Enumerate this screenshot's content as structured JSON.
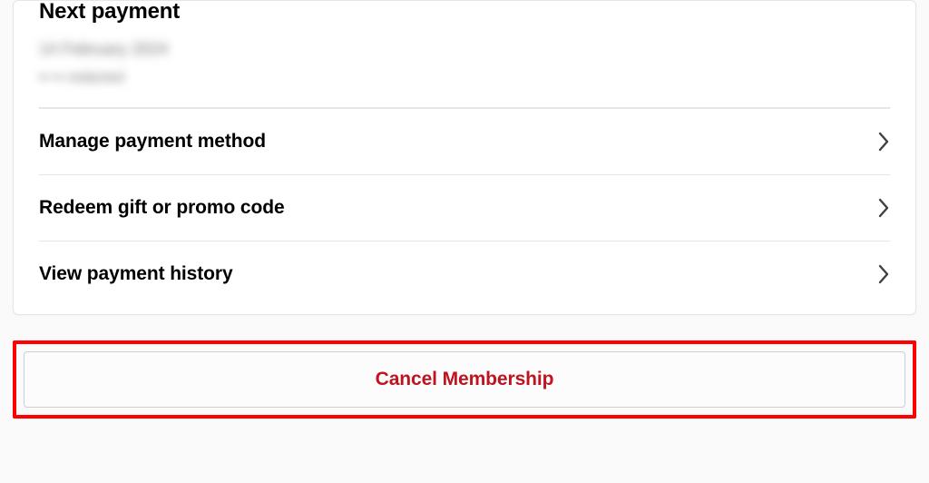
{
  "payment": {
    "section_title": "Next payment",
    "next_date_redacted": "14 February 2024",
    "method_redacted": "•• •• redacted"
  },
  "rows": {
    "manage_payment": "Manage payment method",
    "redeem_code": "Redeem gift or promo code",
    "view_history": "View payment history"
  },
  "cancel": {
    "label": "Cancel Membership"
  },
  "colors": {
    "danger": "#c1121f",
    "highlight_border": "#ff0000"
  }
}
